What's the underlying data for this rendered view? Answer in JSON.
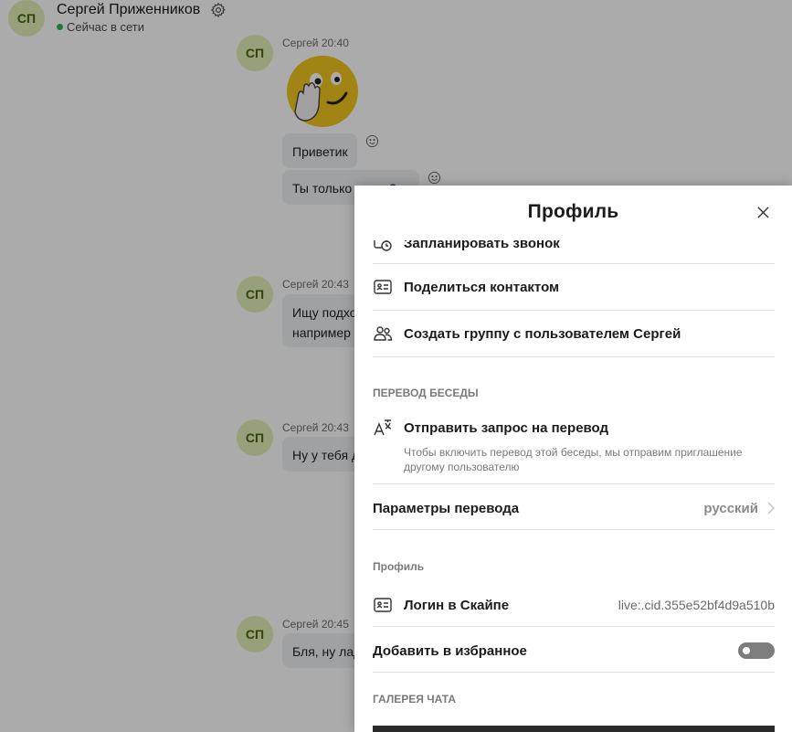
{
  "header": {
    "avatar_initials": "СП",
    "contact_name": "Сергей Приженников",
    "status": "Сейчас в сети",
    "status_color": "#2db84d",
    "settings_icon": "gear-icon"
  },
  "messages": [
    {
      "initials": "СП",
      "meta": "Сергей 20:40",
      "sticker": "waving-emoji-sticker",
      "bubbles": [
        "Приветик",
        "Ты только узнал?"
      ]
    },
    {
      "initials": "СП",
      "meta": "Сергей 20:43",
      "bubbles": [
        "Ищу подходящий вариант",
        "например"
      ]
    },
    {
      "initials": "СП",
      "meta": "Сергей 20:43",
      "bubbles": [
        "Ну у тебя д"
      ]
    },
    {
      "initials": "СП",
      "meta": "Сергей 20:45",
      "bubbles": [
        "Бля, ну лад"
      ]
    }
  ],
  "panel": {
    "title": "Профиль",
    "actions": {
      "schedule_call": "Запланировать звонок",
      "share_contact": "Поделиться контактом",
      "create_group": "Создать группу с пользователем Сергей"
    },
    "translation": {
      "section": "ПЕРЕВОД БЕСЕДЫ",
      "request": "Отправить запрос на перевод",
      "hint": "Чтобы включить перевод этой беседы, мы отправим приглашение другому пользователю",
      "settings_label": "Параметры перевода",
      "settings_value": "русский"
    },
    "profile": {
      "section": "Профиль",
      "login_label": "Логин в Скайпе",
      "login_value": "live:.cid.355e52bf4d9a510b",
      "favorites_label": "Добавить в избранное",
      "favorites_on": false
    },
    "gallery_section": "ГАЛЕРЕЯ ЧАТА"
  }
}
